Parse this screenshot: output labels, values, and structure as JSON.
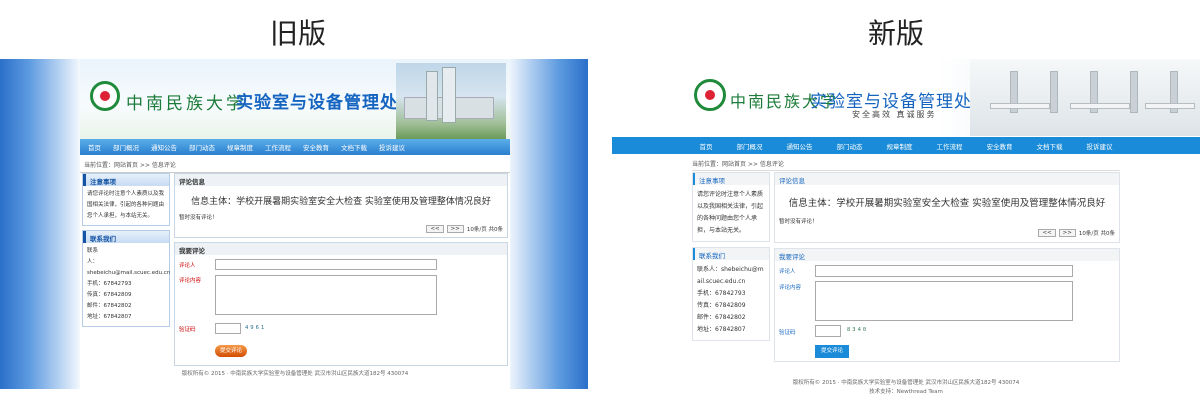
{
  "labels": {
    "old": "旧版",
    "new": "新版"
  },
  "colors": {
    "old_nav": "#2a7fcf",
    "new_nav": "#1a8bd8",
    "logo_green": "#1d7c3a",
    "title_blue": "#1565c0",
    "submit_orange": "#d24c00"
  },
  "old": {
    "university": "中南民族大学",
    "department": "实验室与设备管理处",
    "nav": [
      "首页",
      "部门概况",
      "通知公告",
      "部门动态",
      "规章制度",
      "工作流程",
      "安全教育",
      "文档下载",
      "投诉建议"
    ],
    "breadcrumb": "当前位置：网站首页 >> 信息评论",
    "notice": {
      "title": "注意事项",
      "body": "请您评论时注意个人素质以及我国相关法律，引起的各种问题由您个人承担，与本站无关。"
    },
    "contact": {
      "title": "联系我们",
      "lines": [
        "联系",
        "人：shebeichu@mail.scuec.edu.cn",
        "手机：67842793",
        "传真：67842809",
        "邮件：67842802",
        "地址：67842807"
      ]
    },
    "comment_info": {
      "title": "评论信息",
      "subject": "信息主体：学校开展暑期实验室安全大检查 实验室使用及管理整体情况良好",
      "empty": "暂时没有评论！",
      "prev": "<<",
      "next": ">>",
      "page_info": "10条/页 共0条"
    },
    "form": {
      "title": "我要评论",
      "name_label": "评论人",
      "content_label": "评论内容",
      "captcha_label": "验证码",
      "captcha_value": "4961",
      "submit": "提交评论"
    },
    "footer": "版权所有© 2015 · 中南民族大学实验室与设备管理处 武汉市洪山区民族大道182号 430074"
  },
  "new": {
    "university": "中南民族大学",
    "department": "实验室与设备管理处",
    "slogan": "安全高效 真诚服务",
    "nav": [
      "首页",
      "部门概况",
      "通知公告",
      "部门动态",
      "规章制度",
      "工作流程",
      "安全教育",
      "文档下载",
      "投诉建议"
    ],
    "breadcrumb": "当前位置：网站首页 >> 信息评论",
    "notice": {
      "title": "注意事项",
      "body": "请您评论时注意个人素质以及我国相关法律，引起的各种问题由您个人承担，与本站无关。"
    },
    "contact": {
      "title": "联系我们",
      "lines": [
        "联系人：shebeichu@m",
        "ail.scuec.edu.cn",
        "手机：67842793",
        "传真：67842809",
        "邮件：67842802",
        "地址：67842807"
      ]
    },
    "comment_info": {
      "title": "评论信息",
      "subject": "信息主体：学校开展暑期实验室安全大检查 实验室使用及管理整体情况良好",
      "empty": "暂时没有评论！",
      "prev": "<<",
      "next": ">>",
      "page_info": "10条/页 共0条"
    },
    "form": {
      "title": "我要评论",
      "name_label": "评论人",
      "content_label": "评论内容",
      "captcha_label": "验证码",
      "captcha_value": "8340",
      "submit": "提交评论"
    },
    "footer": "版权所有© 2015 · 中南民族大学实验室与设备管理处 武汉市洪山区民族大道182号 430074",
    "support": "技术支持：Newthread Team"
  }
}
